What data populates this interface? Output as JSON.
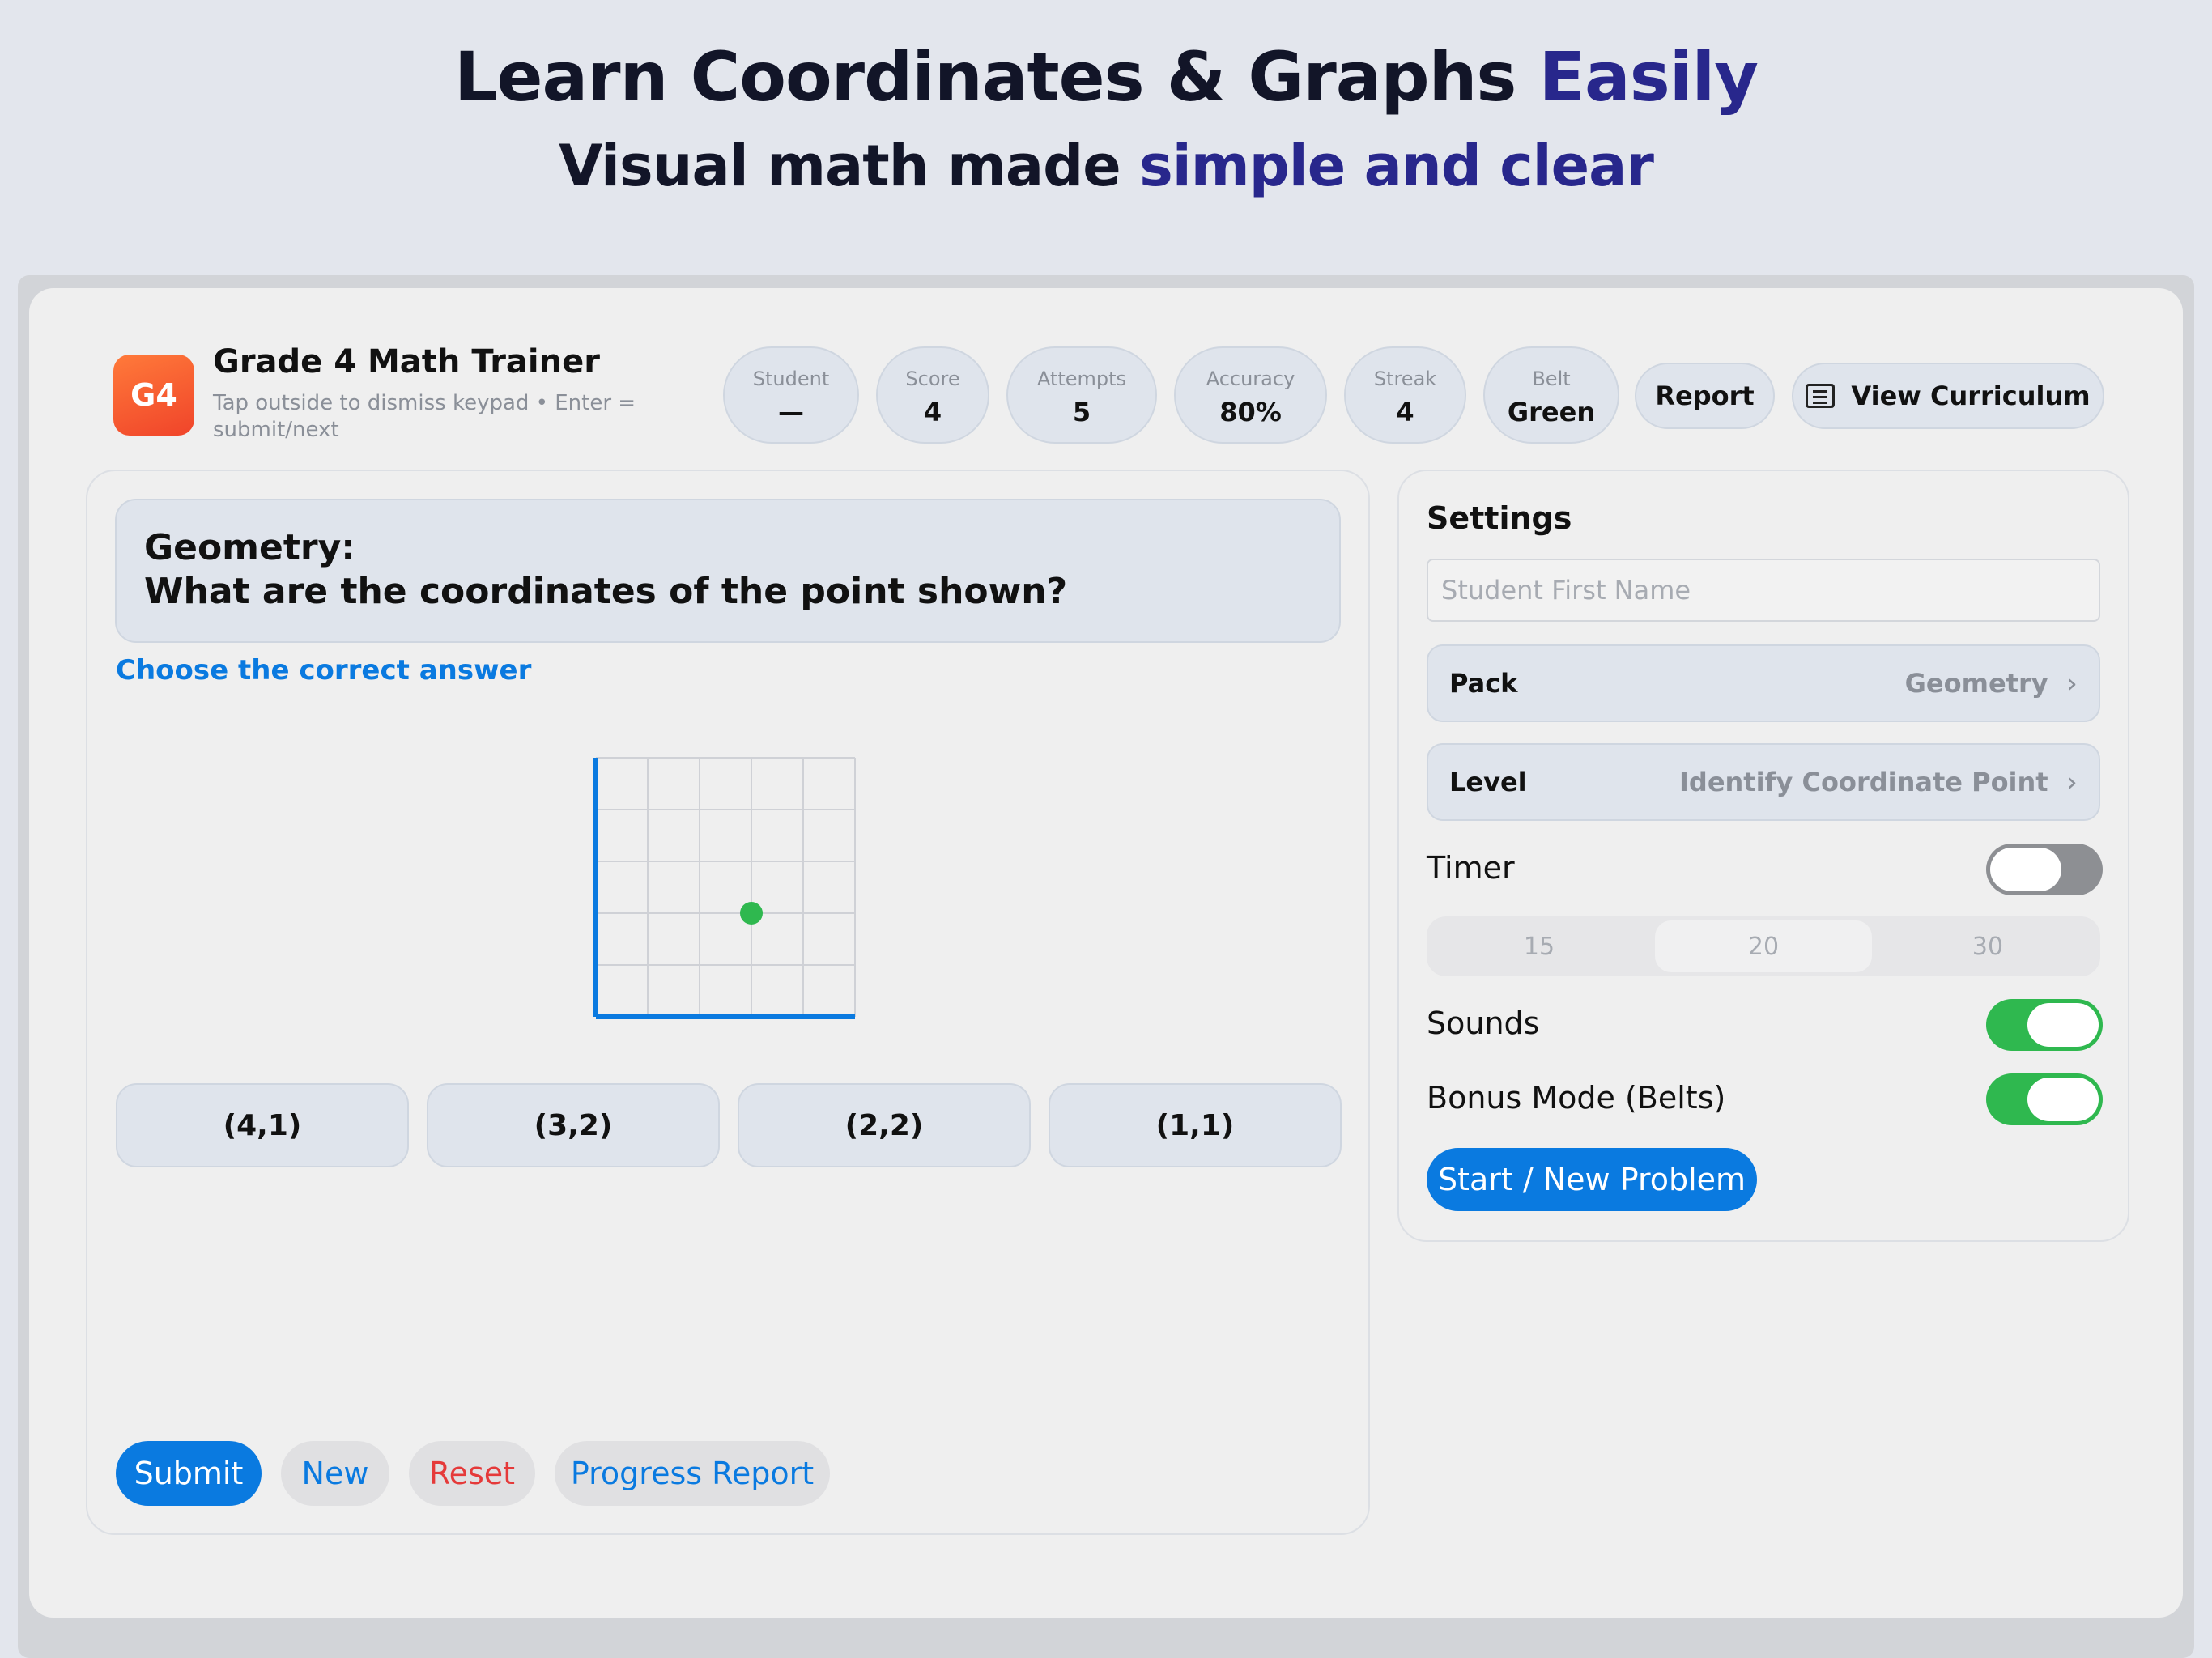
{
  "marketing": {
    "headline_part1": "Learn Coordinates & Graphs",
    "headline_part2": "Easily",
    "subheadline_part1": "Visual math made",
    "subheadline_part2": "simple and clear"
  },
  "app": {
    "logo_text": "G4",
    "title": "Grade 4 Math Trainer",
    "subtitle": "Tap outside to dismiss keypad • Enter = submit/next"
  },
  "stats": [
    {
      "label": "Student",
      "value": "—"
    },
    {
      "label": "Score",
      "value": "4"
    },
    {
      "label": "Attempts",
      "value": "5"
    },
    {
      "label": "Accuracy",
      "value": "80%"
    },
    {
      "label": "Streak",
      "value": "4"
    },
    {
      "label": "Belt",
      "value": "Green"
    }
  ],
  "header_buttons": {
    "report": "Report",
    "view_curriculum": "View Curriculum"
  },
  "question": {
    "category": "Geometry:",
    "text": "What are the coordinates of the point shown?",
    "instruction": "Choose the correct answer"
  },
  "graph": {
    "grid_size": 5,
    "point": {
      "x": 3,
      "y": 2
    },
    "axis_color": "#0a7ae0",
    "point_color": "#2fb84f"
  },
  "answers": [
    "(4,1)",
    "(3,2)",
    "(2,2)",
    "(1,1)"
  ],
  "actions": {
    "submit": "Submit",
    "new": "New",
    "reset": "Reset",
    "progress_report": "Progress Report"
  },
  "settings": {
    "title": "Settings",
    "name_placeholder": "Student First Name",
    "pack_label": "Pack",
    "pack_value": "Geometry",
    "level_label": "Level",
    "level_value": "Identify Coordinate Point",
    "timer_label": "Timer",
    "timer_on": false,
    "timer_options": [
      "15",
      "20",
      "30"
    ],
    "timer_selected": "20",
    "sounds_label": "Sounds",
    "sounds_on": true,
    "bonus_label": "Bonus Mode (Belts)",
    "bonus_on": true,
    "start_button": "Start / New Problem"
  },
  "colors": {
    "accent": "#0a7ae0",
    "success": "#2fb84f",
    "danger": "#e53a3a"
  }
}
